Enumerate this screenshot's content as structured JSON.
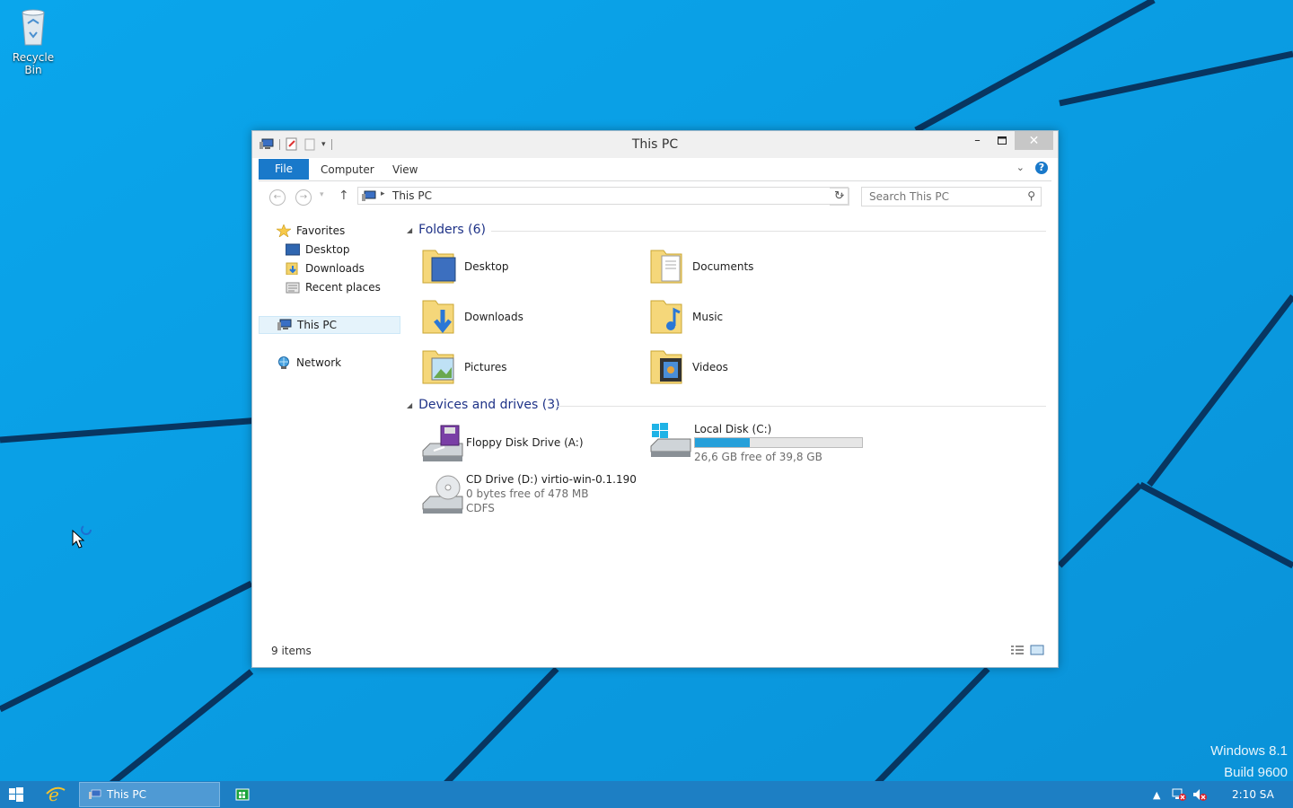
{
  "desktop": {
    "recycle_bin_label": "Recycle Bin",
    "watermark_line1": "Windows 8.1",
    "watermark_line2": "Build 9600"
  },
  "window": {
    "title": "This PC",
    "ribbon": {
      "file": "File",
      "computer": "Computer",
      "view": "View",
      "help": "?"
    },
    "address": {
      "path": "This PC"
    },
    "search": {
      "placeholder": "Search This PC"
    }
  },
  "nav_pane": {
    "favorites": "Favorites",
    "desktop": "Desktop",
    "downloads": "Downloads",
    "recent_places": "Recent places",
    "this_pc": "This PC",
    "network": "Network"
  },
  "content": {
    "folders_header": "Folders (6)",
    "folders": [
      {
        "name": "Desktop",
        "icon": "desktop-folder-icon"
      },
      {
        "name": "Documents",
        "icon": "documents-folder-icon"
      },
      {
        "name": "Downloads",
        "icon": "downloads-folder-icon"
      },
      {
        "name": "Music",
        "icon": "music-folder-icon"
      },
      {
        "name": "Pictures",
        "icon": "pictures-folder-icon"
      },
      {
        "name": "Videos",
        "icon": "videos-folder-icon"
      }
    ],
    "drives_header": "Devices and drives (3)",
    "drives": {
      "floppy": {
        "name": "Floppy Disk Drive (A:)"
      },
      "local": {
        "name": "Local Disk (C:)",
        "free": "26,6 GB free of 39,8 GB",
        "used_fraction": 0.33
      },
      "cd": {
        "name": "CD Drive (D:) virtio-win-0.1.190",
        "free": "0 bytes free of 478 MB",
        "fs": "CDFS"
      }
    }
  },
  "status_bar": {
    "items": "9 items"
  },
  "taskbar": {
    "active_task": "This PC",
    "clock": "2:10 SA",
    "color": "#1d7fc4"
  },
  "colors": {
    "accent": "#1979ca",
    "desktop": "#0a9fe6",
    "drive_bar": "#26a0da"
  }
}
